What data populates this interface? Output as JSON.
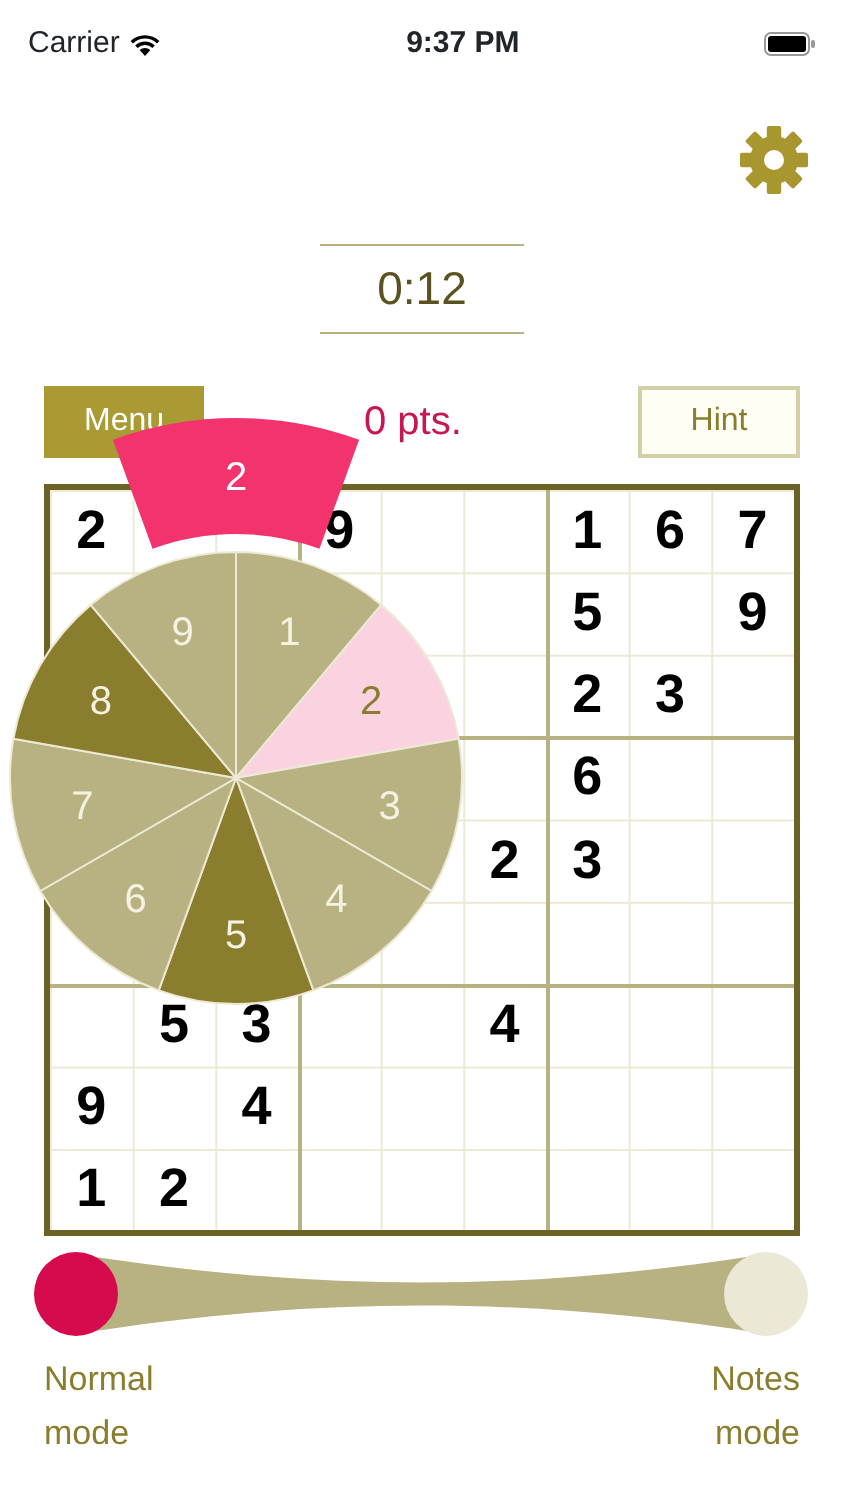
{
  "status_bar": {
    "carrier": "Carrier",
    "time": "9:37 PM"
  },
  "timer": "0:12",
  "menu_button": "Menu",
  "score": "0 pts.",
  "hint_button": "Hint",
  "grid": {
    "row_1": {
      "column_1": "2",
      "column_4": "9",
      "column_7": "1",
      "column_8": "6",
      "column_9": "7"
    },
    "row_2": {
      "column_7": "5",
      "column_9": "9"
    },
    "row_3": {
      "column_7": "2",
      "column_8": "3"
    },
    "row_4": {
      "column_7": "6"
    },
    "row_5": {
      "column_6": "2",
      "column_7": "3"
    },
    "row_7": {
      "column_2": "5",
      "column_3": "3",
      "column_6": "4"
    },
    "row_8": {
      "column_1": "9",
      "column_3": "4"
    },
    "row_9": {
      "column_1": "1",
      "column_2": "2"
    }
  },
  "number_wheel": {
    "preview": "2",
    "segments": [
      {
        "label": "1",
        "selected": false,
        "kind": "light"
      },
      {
        "label": "2",
        "selected": true
      },
      {
        "label": "3",
        "selected": false,
        "kind": "light"
      },
      {
        "label": "4",
        "selected": false,
        "kind": "light"
      },
      {
        "label": "5",
        "selected": false,
        "kind": "dark"
      },
      {
        "label": "6",
        "selected": false,
        "kind": "light"
      },
      {
        "label": "7",
        "selected": false,
        "kind": "light"
      },
      {
        "label": "8",
        "selected": false,
        "kind": "dark"
      },
      {
        "label": "9",
        "selected": false,
        "kind": "light"
      }
    ]
  },
  "modes": [
    {
      "label": "Normal mode",
      "selected": true
    },
    {
      "label": "Notes mode",
      "selected": false
    }
  ]
}
